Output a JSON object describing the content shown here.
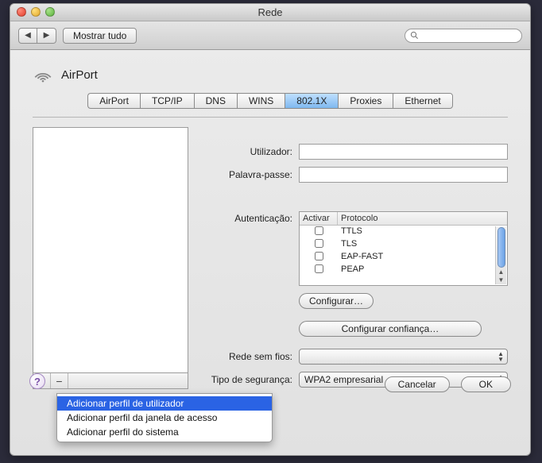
{
  "window": {
    "title": "Rede"
  },
  "toolbar": {
    "show_all": "Mostrar tudo",
    "search_placeholder": ""
  },
  "heading": {
    "title": "AirPort"
  },
  "tabs": [
    {
      "label": "AirPort"
    },
    {
      "label": "TCP/IP"
    },
    {
      "label": "DNS"
    },
    {
      "label": "WINS"
    },
    {
      "label": "802.1X",
      "active": true
    },
    {
      "label": "Proxies"
    },
    {
      "label": "Ethernet"
    }
  ],
  "form": {
    "user_label": "Utilizador:",
    "password_label": "Palavra-passe:",
    "auth_label": "Autenticação:",
    "auth_columns": {
      "enable": "Activar",
      "protocol": "Protocolo"
    },
    "auth_rows": [
      {
        "enabled": false,
        "protocol": "TTLS"
      },
      {
        "enabled": false,
        "protocol": "TLS"
      },
      {
        "enabled": false,
        "protocol": "EAP-FAST"
      },
      {
        "enabled": false,
        "protocol": "PEAP"
      }
    ],
    "configure_btn": "Configurar…",
    "configure_trust_btn": "Configurar confiança…",
    "wireless_label": "Rede sem fios:",
    "wireless_value": "",
    "security_label": "Tipo de segurança:",
    "security_value": "WPA2 empresarial"
  },
  "add_menu": {
    "items": [
      "Adicionar perfil de utilizador",
      "Adicionar perfil da janela de acesso",
      "Adicionar perfil do sistema"
    ],
    "selected_index": 0
  },
  "footer": {
    "cancel": "Cancelar",
    "ok": "OK"
  }
}
